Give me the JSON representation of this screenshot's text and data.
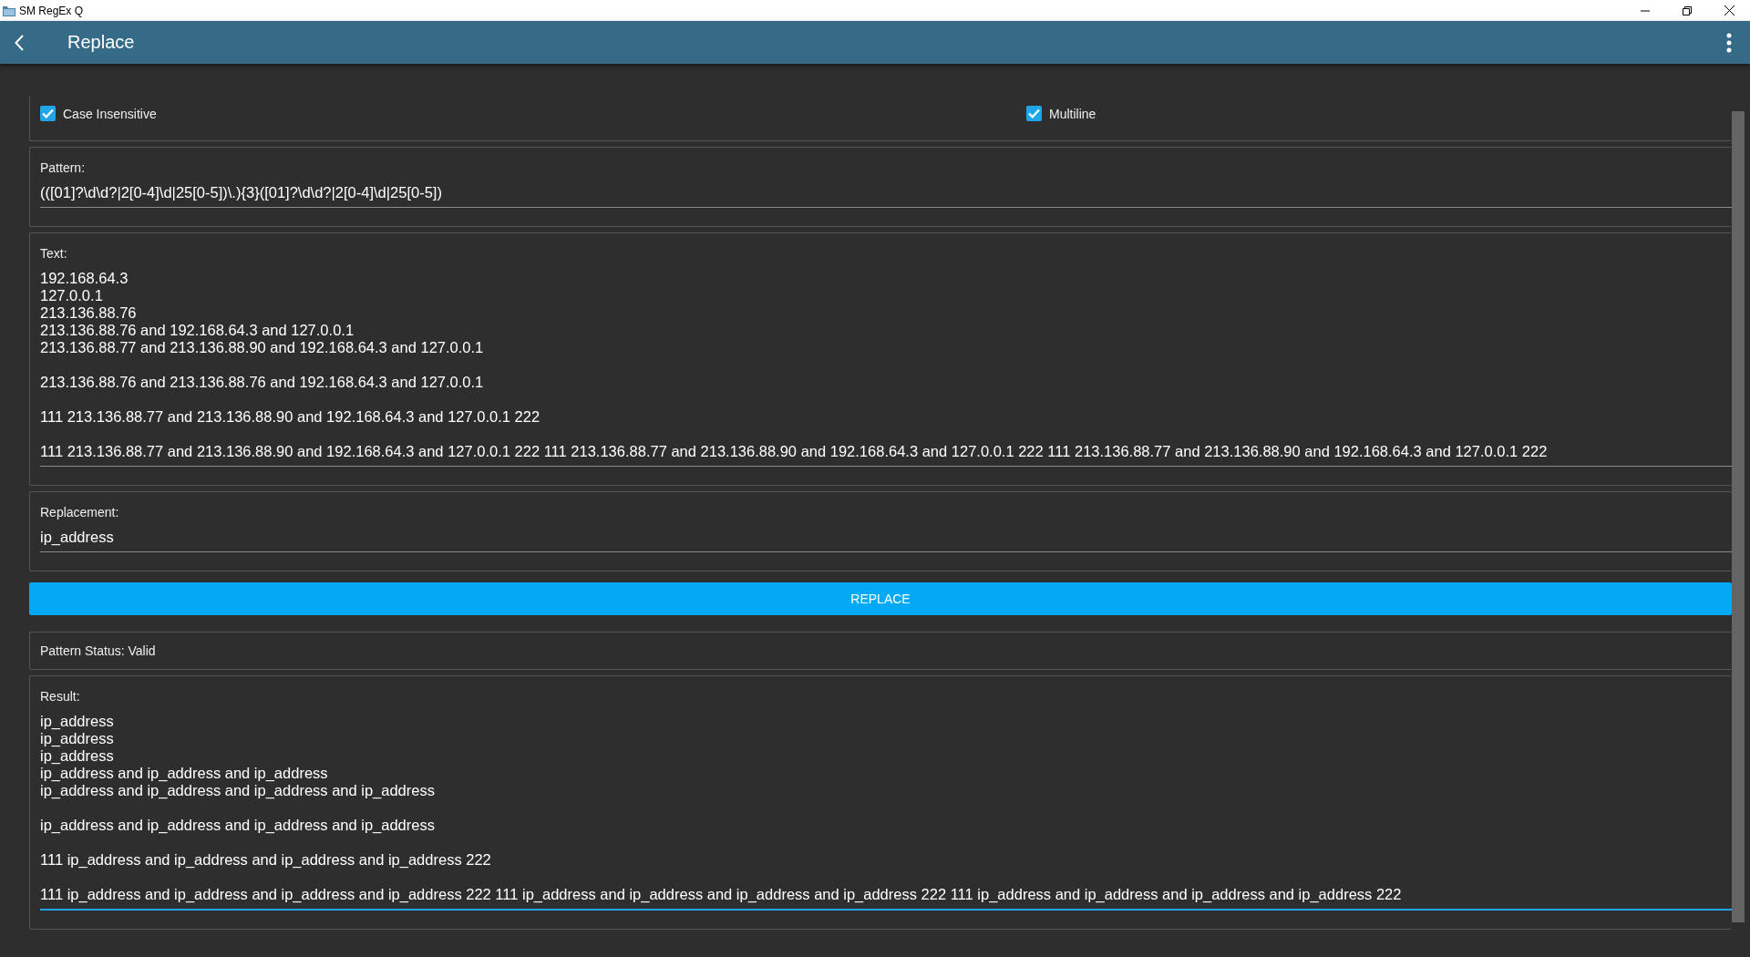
{
  "window": {
    "title": "SM RegEx Q"
  },
  "app_bar": {
    "title": "Replace"
  },
  "options": [
    {
      "label": "Case Insensitive",
      "checked": true
    },
    {
      "label": "Multiline",
      "checked": true
    }
  ],
  "pattern": {
    "label": "Pattern:",
    "value": "(([01]?\\d\\d?|2[0-4]\\d|25[0-5])\\.){3}([01]?\\d\\d?|2[0-4]\\d|25[0-5])",
    "focused": false
  },
  "text": {
    "label": "Text:",
    "value": "192.168.64.3\n127.0.0.1\n213.136.88.76\n213.136.88.76 and 192.168.64.3 and 127.0.0.1\n213.136.88.77 and 213.136.88.90 and 192.168.64.3 and 127.0.0.1\n\n213.136.88.76 and 213.136.88.76 and 192.168.64.3 and 127.0.0.1\n\n111 213.136.88.77 and 213.136.88.90 and 192.168.64.3 and 127.0.0.1 222\n\n111 213.136.88.77 and 213.136.88.90 and 192.168.64.3 and 127.0.0.1 222 111 213.136.88.77 and 213.136.88.90 and 192.168.64.3 and 127.0.0.1 222 111 213.136.88.77 and 213.136.88.90 and 192.168.64.3 and 127.0.0.1 222",
    "focused": false
  },
  "replacement": {
    "label": "Replacement:",
    "value": "ip_address",
    "focused": false
  },
  "replace_button": "REPLACE",
  "status": "Pattern Status: Valid",
  "result": {
    "label": "Result:",
    "value": "ip_address\nip_address\nip_address\nip_address and ip_address and ip_address\nip_address and ip_address and ip_address and ip_address\n\nip_address and ip_address and ip_address and ip_address\n\n111 ip_address and ip_address and ip_address and ip_address 222\n\n111 ip_address and ip_address and ip_address and ip_address 222 111 ip_address and ip_address and ip_address and ip_address 222 111 ip_address and ip_address and ip_address and ip_address 222",
    "focused": true
  }
}
